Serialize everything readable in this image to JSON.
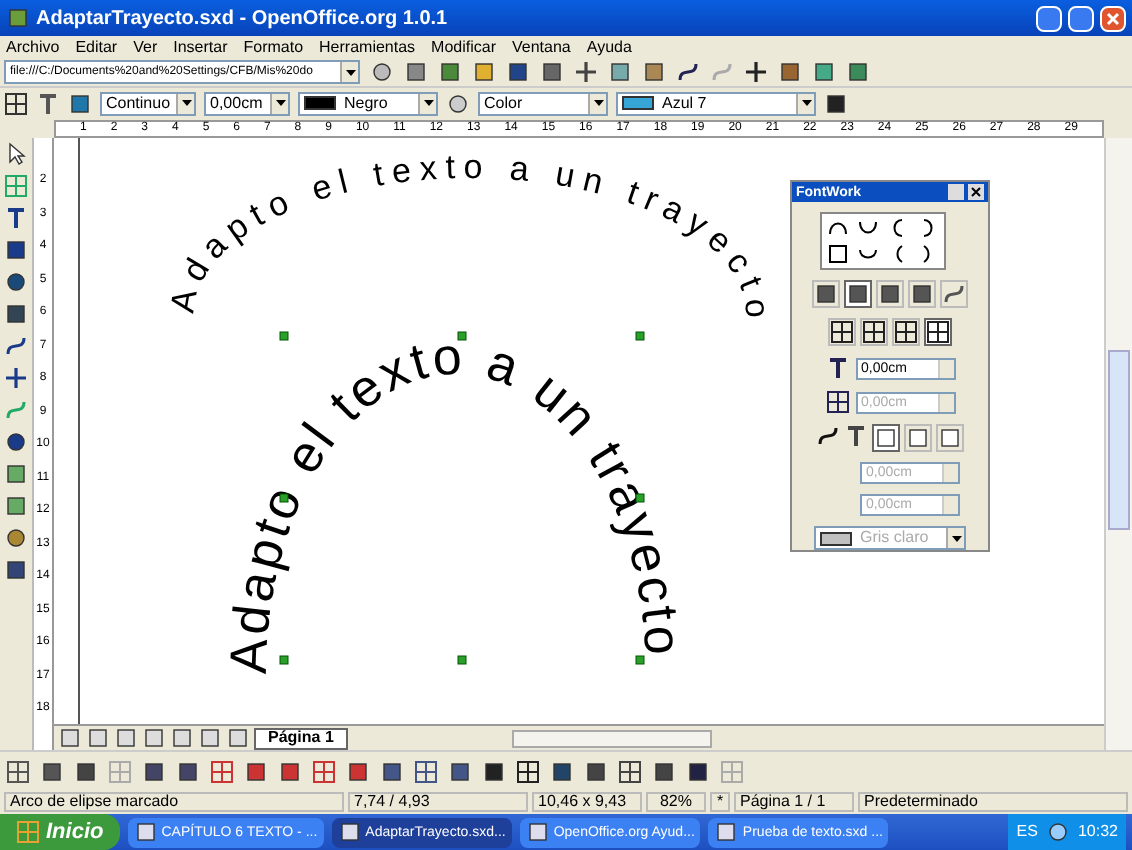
{
  "window": {
    "title": "AdaptarTrayecto.sxd - OpenOffice.org 1.0.1"
  },
  "menu": [
    "Archivo",
    "Editar",
    "Ver",
    "Insertar",
    "Formato",
    "Herramientas",
    "Modificar",
    "Ventana",
    "Ayuda"
  ],
  "url_box": {
    "value": "file:///C:/Documents%20and%20Settings/CFB/Mis%20do"
  },
  "line_toolbar": {
    "line_style": "Continuo",
    "line_width": "0,00cm",
    "line_color": "Negro",
    "fill_type": "Color",
    "fill_color": "Azul 7"
  },
  "ruler_h": [
    "1",
    "2",
    "3",
    "4",
    "5",
    "6",
    "7",
    "8",
    "9",
    "10",
    "11",
    "12",
    "13",
    "14",
    "15",
    "16",
    "17",
    "18",
    "19",
    "20",
    "21",
    "22",
    "23",
    "24",
    "25",
    "26",
    "27",
    "28",
    "29"
  ],
  "ruler_v": [
    "2",
    "3",
    "4",
    "5",
    "6",
    "7",
    "8",
    "9",
    "10",
    "11",
    "12",
    "13",
    "14",
    "15",
    "16",
    "17",
    "18"
  ],
  "canvas": {
    "curved_texts": [
      {
        "text": "Adapto el texto a un trayecto"
      },
      {
        "text": "Adapto el texto a un trayecto"
      }
    ]
  },
  "fontwork": {
    "title": "FontWork",
    "style_buttons": [
      {
        "selected": false
      },
      {
        "selected": true
      },
      {
        "selected": false
      },
      {
        "selected": false
      },
      {
        "selected": false
      }
    ],
    "align_buttons": [
      {
        "selected": false
      },
      {
        "selected": false
      },
      {
        "selected": false
      },
      {
        "selected": true
      }
    ],
    "distance": {
      "value": "0,00cm",
      "disabled": false
    },
    "indent": {
      "value": "0,00cm",
      "disabled": true
    },
    "shadow_buttons": [
      {
        "selected": true
      },
      {
        "selected": false
      },
      {
        "selected": false
      }
    ],
    "shadow_x": {
      "value": "0,00cm",
      "disabled": true
    },
    "shadow_y": {
      "value": "0,00cm",
      "disabled": true
    },
    "shadow_color": {
      "value": "Gris claro",
      "disabled": true
    }
  },
  "page_tabs": [
    {
      "label": "Página 1",
      "selected": true
    }
  ],
  "status_bar": {
    "message": "Arco de elipse marcado",
    "position": "7,74 / 4,93",
    "size": "10,46 x 9,43",
    "zoom": "82%",
    "modified": "*",
    "page": "Página 1 / 1",
    "style": "Predeterminado"
  },
  "taskbar": {
    "start": "Inicio",
    "tasks": [
      {
        "label": "CAPÍTULO 6 TEXTO - ...",
        "selected": false
      },
      {
        "label": "AdaptarTrayecto.sxd...",
        "selected": true
      },
      {
        "label": "OpenOffice.org Ayud...",
        "selected": false
      },
      {
        "label": "Prueba de texto.sxd ...",
        "selected": false
      }
    ],
    "language": "ES",
    "clock": "10:32"
  }
}
